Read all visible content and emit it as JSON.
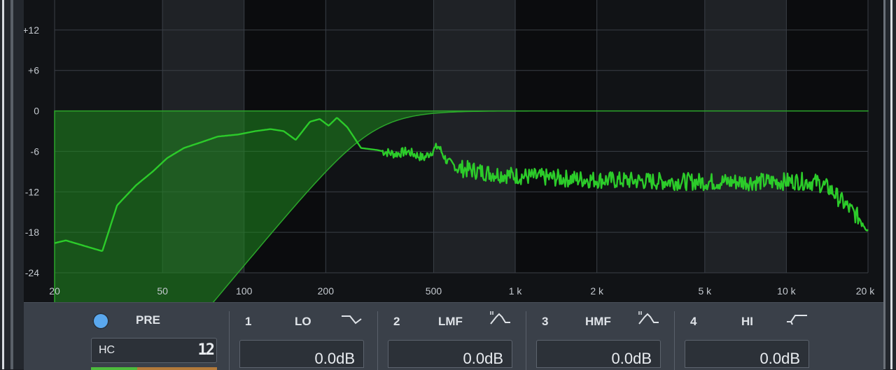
{
  "graph": {
    "db_labels": [
      "+12",
      "+6",
      "0",
      "-6",
      "-12",
      "-18",
      "-24"
    ],
    "db_values": [
      12,
      6,
      0,
      -6,
      -12,
      -18,
      -24
    ],
    "freq_labels": [
      "20",
      "50",
      "100",
      "200",
      "500",
      "1 k",
      "2 k",
      "5 k",
      "10 k",
      "20 k"
    ],
    "freq_values": [
      20,
      50,
      100,
      200,
      500,
      1000,
      2000,
      5000,
      10000,
      20000
    ],
    "colors": {
      "background": "#111316",
      "band_light": "#1f2226",
      "band_dark": "#0b0c0e",
      "grid": "#3a3f46",
      "curve": "#2ccb2a",
      "fill": "#1f8a1f"
    }
  },
  "panel": {
    "pre": {
      "label": "PRE",
      "indicator_color": "#5aa8ee"
    },
    "hc": {
      "label": "HC",
      "value": "12"
    },
    "bands": [
      {
        "num": "1",
        "name": "LO",
        "gain": "0.0dB",
        "icon": "low-shelf-icon"
      },
      {
        "num": "2",
        "name": "LMF",
        "gain": "0.0dB",
        "icon": "peak-icon"
      },
      {
        "num": "3",
        "name": "HMF",
        "gain": "0.0dB",
        "icon": "peak-icon"
      },
      {
        "num": "4",
        "name": "HI",
        "gain": "0.0dB",
        "icon": "high-shelf-icon"
      }
    ]
  }
}
